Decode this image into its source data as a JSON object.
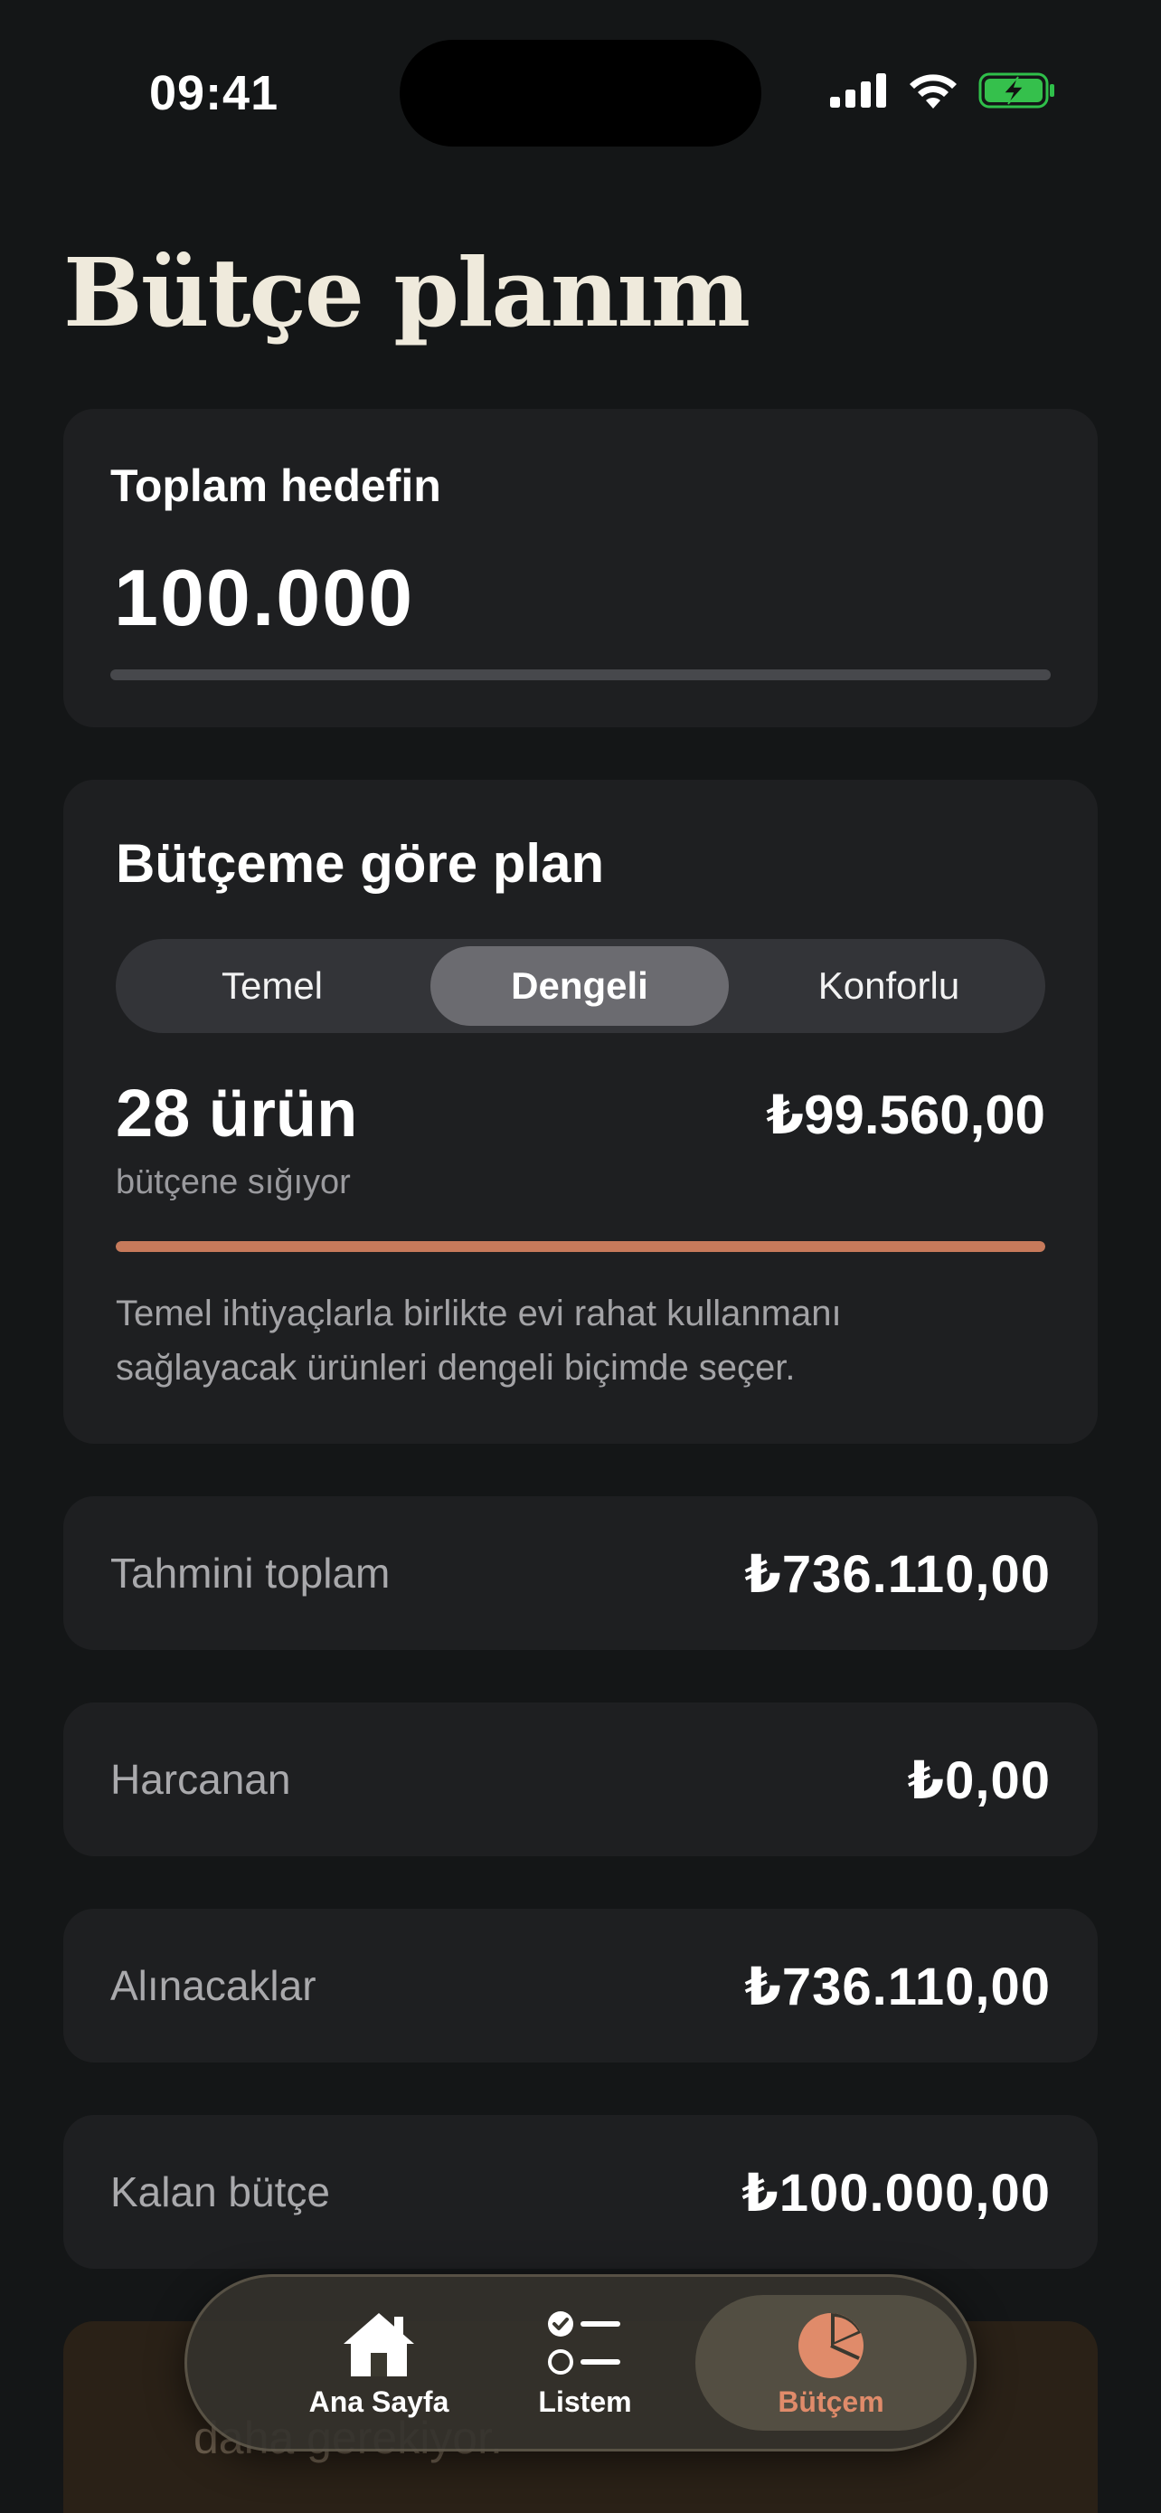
{
  "status_bar": {
    "time": "09:41"
  },
  "page": {
    "title": "Bütçe planım"
  },
  "goal": {
    "label": "Toplam hedefin",
    "value": "100.000"
  },
  "plan": {
    "title": "Bütçeme göre plan",
    "options": [
      "Temel",
      "Dengeli",
      "Konforlu"
    ],
    "selected": "Dengeli",
    "count": "28 ürün",
    "count_caption": "bütçene sığıyor",
    "total": "₺99.560,00",
    "progress": 1.0,
    "description": "Temel ihtiyaçlarla birlikte evi rahat kullanmanı sağlayacak ürünleri dengeli biçimde seçer."
  },
  "stats": [
    {
      "label": "Tahmini toplam",
      "value": "₺736.110,00"
    },
    {
      "label": "Harcanan",
      "value": "₺0,00"
    },
    {
      "label": "Alınacaklar",
      "value": "₺736.110,00"
    },
    {
      "label": "Kalan bütçe",
      "value": "₺100.000,00"
    }
  ],
  "warning": {
    "text": "daha gerekiyor."
  },
  "tabbar": {
    "tabs": [
      {
        "label": "Ana Sayfa",
        "icon": "home-icon"
      },
      {
        "label": "Listem",
        "icon": "checklist-icon"
      },
      {
        "label": "Bütçem",
        "icon": "pie-chart-icon"
      }
    ],
    "active": "Bütçem",
    "accent": "#e08b6a"
  },
  "colors": {
    "background": "#141617",
    "card": "#1e1f21",
    "accent": "#c77a5b",
    "title": "#efeadc"
  }
}
